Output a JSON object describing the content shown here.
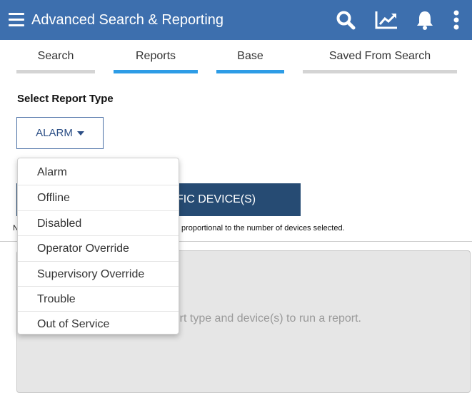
{
  "header": {
    "title": "Advanced Search & Reporting",
    "icons": [
      "menu-icon",
      "search-icon",
      "chart-icon",
      "bell-icon",
      "kebab-icon"
    ],
    "background": "#3d6fae"
  },
  "tabs": [
    {
      "label": "Search",
      "active": false
    },
    {
      "label": "Reports",
      "active": true
    },
    {
      "label": "Base",
      "active": true
    },
    {
      "label": "Saved From Search",
      "active": false
    }
  ],
  "report_section": {
    "label": "Select Report Type",
    "selected_type": "ALARM",
    "options": [
      "Alarm",
      "Offline",
      "Disabled",
      "Operator Override",
      "Supervisory Override",
      "Trouble",
      "Out of Service"
    ]
  },
  "device_button_label": "CIFIC DEVICE(S)",
  "note_text_left": "N",
  "note_text": "proportional to the number of devices selected.",
  "results": {
    "empty_message": "ort type and device(s) to run a report."
  },
  "colors": {
    "accent": "#2d9ce6",
    "button": "#264b73",
    "tab_inactive": "#d4d4d4"
  }
}
